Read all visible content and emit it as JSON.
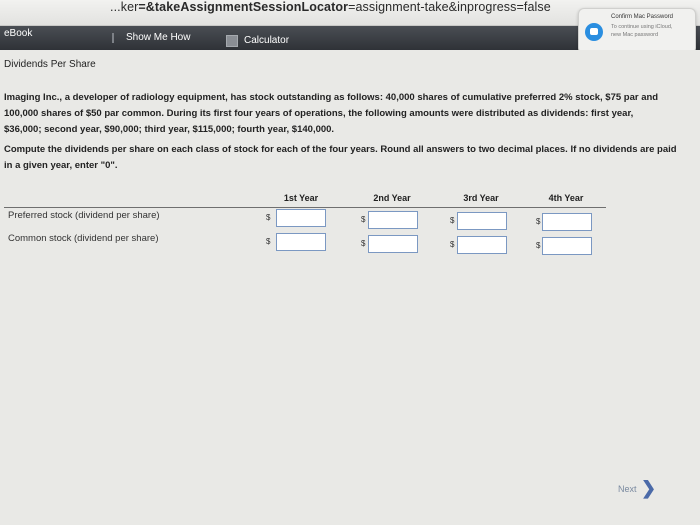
{
  "browser": {
    "url_bold": "=&takeAssignmentSessionLocator",
    "url_rest": "=assignment-take&inprogress=false",
    "url_prefix": "...ker"
  },
  "toolbar": {
    "ebook_label": "eBook",
    "show_me_how_label": "Show Me How",
    "calculator_label": "Calculator"
  },
  "notification": {
    "title": "Confirm Mac Password",
    "line1": "To continue using iCloud,",
    "line2": "new Mac password"
  },
  "problem": {
    "title": "Dividends Per Share",
    "statement_lines": [
      "Imaging Inc., a developer of radiology equipment, has stock outstanding as follows: 40,000 shares of cumulative preferred 2% stock, $75 par and",
      "100,000 shares of $50 par common. During its first four years of operations, the following amounts were distributed as dividends: first year,",
      "$36,000; second year, $90,000; third year, $115,000; fourth year, $140,000."
    ],
    "instruction_lines": [
      "Compute the dividends per share on each class of stock for each of the four years. Round all answers to two decimal places. If no dividends are paid",
      "in a given year, enter \"0\"."
    ]
  },
  "table": {
    "columns": [
      "1st Year",
      "2nd Year",
      "3rd Year",
      "4th Year"
    ],
    "currency_symbol": "$",
    "rows": [
      {
        "label": "Preferred stock (dividend per share)",
        "values": [
          "",
          "",
          "",
          ""
        ]
      },
      {
        "label": "Common stock (dividend per share)",
        "values": [
          "",
          "",
          "",
          ""
        ]
      }
    ]
  },
  "footer": {
    "next_label": "Next",
    "next_icon": "chevron-right-icon"
  }
}
